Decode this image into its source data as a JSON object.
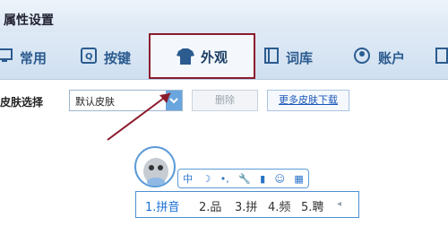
{
  "window": {
    "title": "属性设置"
  },
  "tabs": [
    {
      "label": "常用",
      "icon": "monitor-icon"
    },
    {
      "label": "按键",
      "icon": "key-icon"
    },
    {
      "label": "外观",
      "icon": "tshirt-icon",
      "active": true
    },
    {
      "label": "词库",
      "icon": "book-icon"
    },
    {
      "label": "账户",
      "icon": "user-icon"
    }
  ],
  "skin": {
    "label": "皮肤选择",
    "selected": "默认皮肤",
    "delete_label": "删除",
    "more_label": "更多皮肤下载"
  },
  "ime": {
    "toolbar": [
      "中",
      "☽",
      "•,",
      "🔧",
      "▮",
      "☺",
      "▦"
    ],
    "candidates": [
      "1.拼音",
      "2.品",
      "3.拼",
      "4.频",
      "5.聘"
    ],
    "more": "◂"
  },
  "colors": {
    "accent": "#8b1c2c",
    "brand": "#2b5b8f",
    "link": "#1a56b8"
  }
}
